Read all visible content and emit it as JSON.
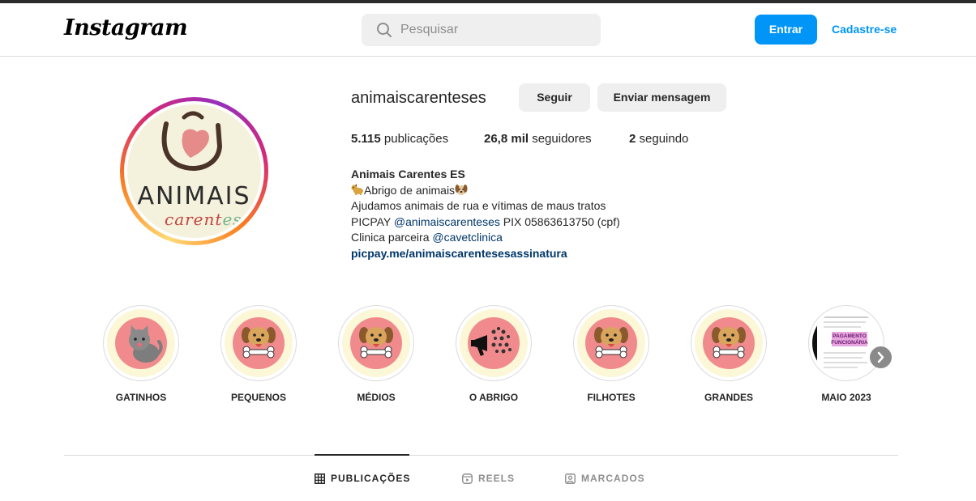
{
  "header": {
    "logo": "Instagram",
    "search_placeholder": "Pesquisar",
    "login_label": "Entrar",
    "signup_label": "Cadastre-se"
  },
  "profile": {
    "avatar_text": "ANIMAIS",
    "avatar_sub": "carent",
    "avatar_sub_es": "es",
    "username": "animaiscarenteses",
    "follow_label": "Seguir",
    "message_label": "Enviar mensagem",
    "stats": {
      "posts_value": "5.115",
      "posts_label": "publicações",
      "followers_value": "26,8 mil",
      "followers_label": "seguidores",
      "following_value": "2",
      "following_label": "seguindo"
    },
    "bio": {
      "name": "Animais Carentes ES",
      "line1": "Abrigo de animais",
      "line2": "Ajudamos animais de rua e vítimas de maus tratos",
      "line3_prefix": "PICPAY ",
      "line3_mention": "@animaiscarenteses",
      "line3_suffix": " PIX 05863613750 (cpf)",
      "line4_prefix": "Clinica parceira ",
      "line4_mention": "@cavetclinica",
      "link": "picpay.me/animaiscarentesesassinatura"
    }
  },
  "highlights": [
    {
      "label": "GATINHOS",
      "icon": "cat-icon"
    },
    {
      "label": "PEQUENOS",
      "icon": "dog-bone-icon"
    },
    {
      "label": "MÉDIOS",
      "icon": "dog-bone-icon"
    },
    {
      "label": "O ABRIGO",
      "icon": "megaphone-icon"
    },
    {
      "label": "FILHOTES",
      "icon": "dog-bone-icon"
    },
    {
      "label": "GRANDES",
      "icon": "dog-bone-icon"
    },
    {
      "label": "MAIO 2023",
      "icon": "document-icon",
      "doc_stamp": "PAGAMENTO FUNCIONÁRIA"
    }
  ],
  "tabs": [
    {
      "label": "PUBLICAÇÕES",
      "icon": "grid-icon",
      "active": true
    },
    {
      "label": "REELS",
      "icon": "reels-icon",
      "active": false
    },
    {
      "label": "MARCADOS",
      "icon": "tagged-icon",
      "active": false
    }
  ],
  "colors": {
    "accent": "#0095f6",
    "link": "#00376b",
    "highlight_blob": "#f08a8c",
    "highlight_bg": "#fbf7d7"
  }
}
